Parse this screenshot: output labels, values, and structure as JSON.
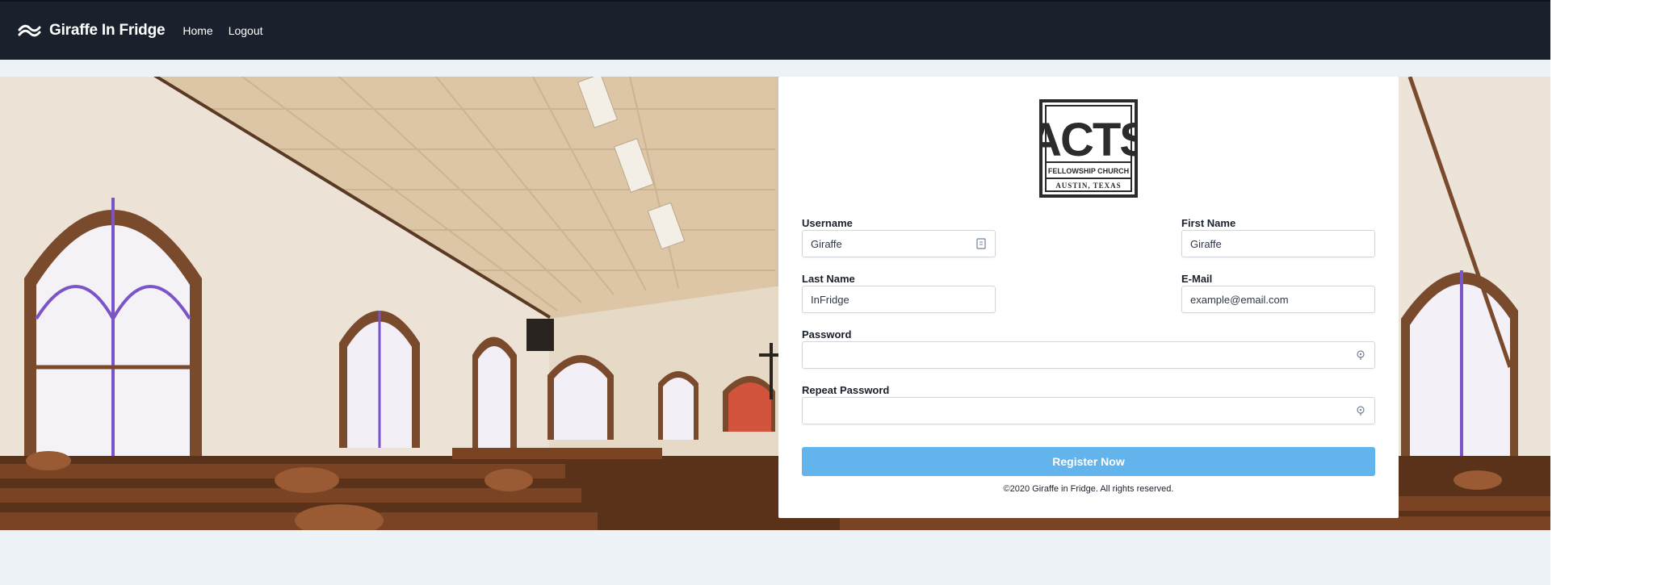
{
  "navbar": {
    "brand": "Giraffe In Fridge",
    "links": [
      "Home",
      "Logout"
    ]
  },
  "logo": {
    "wordmark": "ACTS",
    "line1": "FELLOWSHIP CHURCH",
    "line2": "AUSTIN, TEXAS"
  },
  "form": {
    "username": {
      "label": "Username",
      "value": "Giraffe"
    },
    "first_name": {
      "label": "First Name",
      "value": "Giraffe"
    },
    "last_name": {
      "label": "Last Name",
      "value": "InFridge"
    },
    "email": {
      "label": "E-Mail",
      "value": "example@email.com"
    },
    "password": {
      "label": "Password",
      "value": ""
    },
    "repeat_password": {
      "label": "Repeat Password",
      "value": ""
    },
    "submit_label": "Register Now"
  },
  "footer": {
    "text": "©2020 Giraffe in Fridge. All rights reserved."
  },
  "colors": {
    "navbar": "#1a202c",
    "background": "#edf2f7",
    "button": "#63b3ed"
  }
}
